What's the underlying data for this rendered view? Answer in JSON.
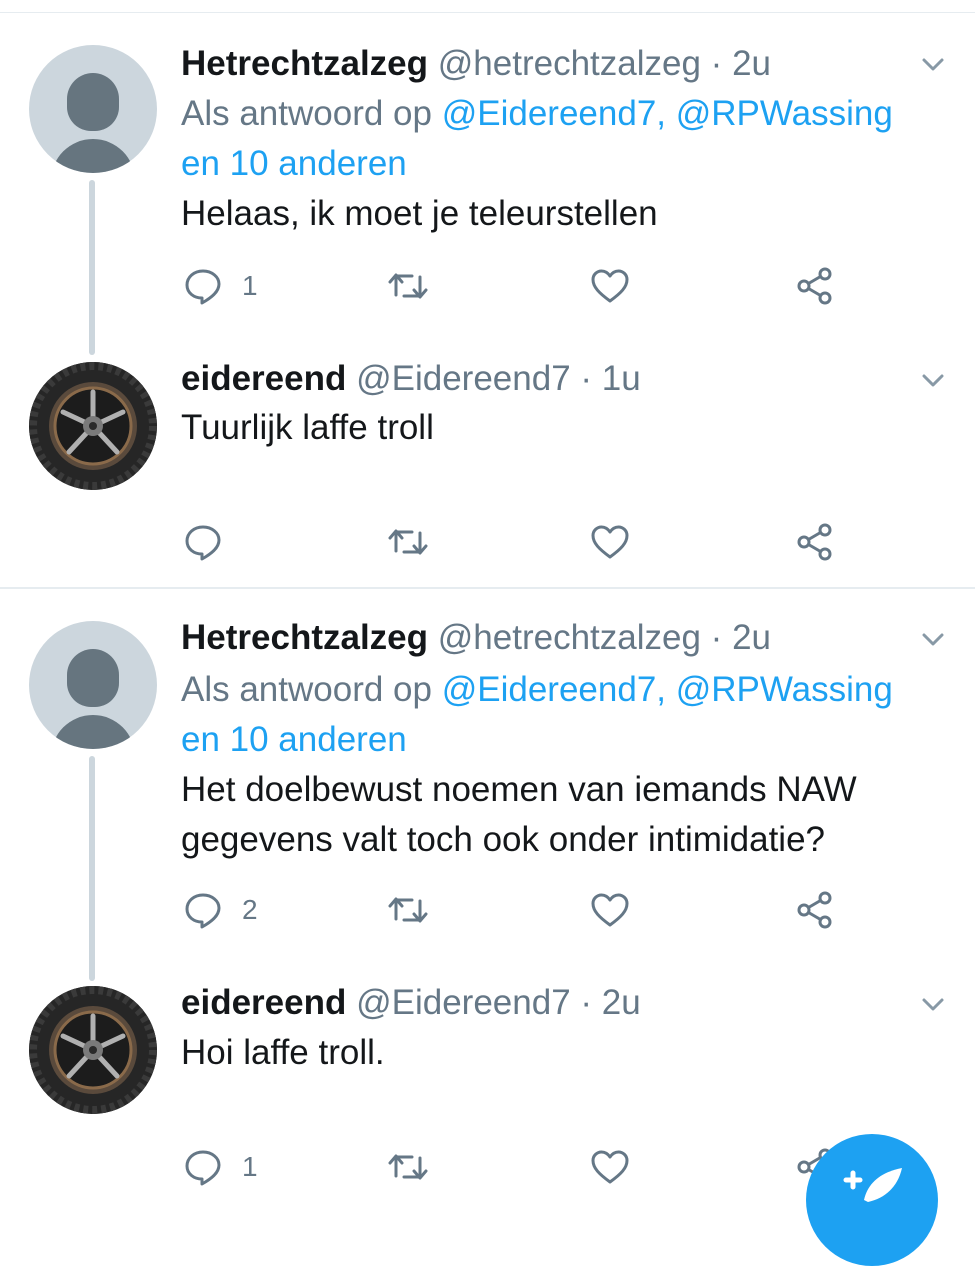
{
  "tweets": [
    {
      "name": "Hetrechtzalzeg",
      "handle": "@hetrechtzalzeg",
      "dot": "·",
      "time": "2u",
      "reply_prefix": "Als antwoord op",
      "mentions": "@Eidereend7, @RPWassing",
      "others": "en 10 anderen",
      "text": "Helaas, ik moet je teleurstellen",
      "reply_count": "1",
      "avatar_icon": "default-avatar-icon"
    },
    {
      "name": "eidereend",
      "handle": "@Eidereend7",
      "dot": "·",
      "time": "1u",
      "text": "Tuurlijk laffe troll",
      "reply_count": "",
      "avatar_icon": "tire-avatar"
    },
    {
      "name": "Hetrechtzalzeg",
      "handle": "@hetrechtzalzeg",
      "dot": "·",
      "time": "2u",
      "reply_prefix": "Als antwoord op",
      "mentions": "@Eidereend7, @RPWassing",
      "others": "en 10 anderen",
      "text_line1": "Het doelbewust noemen van iemands NAW",
      "text_line2": "gegevens valt toch ook onder intimidatie?",
      "reply_count": "2",
      "avatar_icon": "default-avatar-icon"
    },
    {
      "name": "eidereend",
      "handle": "@Eidereend7",
      "dot": "·",
      "time": "2u",
      "text": "Hoi laffe troll.",
      "reply_count": "1",
      "avatar_icon": "tire-avatar"
    }
  ],
  "icons": [
    "reply-icon",
    "retweet-icon",
    "like-icon",
    "share-icon",
    "chevron-down-icon",
    "compose-tweet-icon"
  ],
  "colors": {
    "accent": "#1da1f2",
    "secondary_text": "#657786",
    "border": "#e6ecf0",
    "thread_line": "#ccd6dd"
  }
}
